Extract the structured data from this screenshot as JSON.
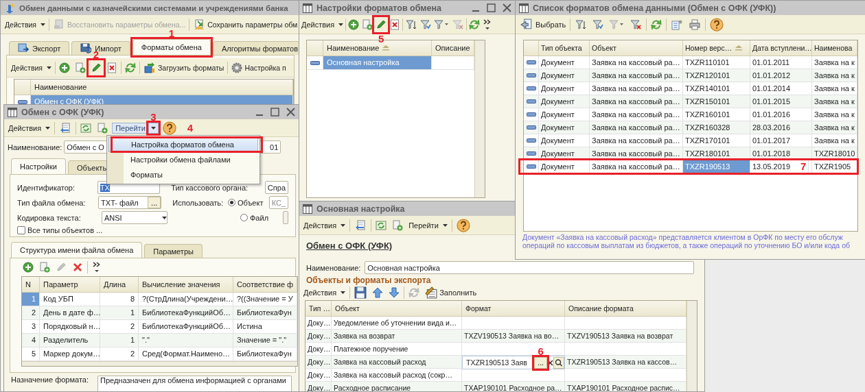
{
  "main_window": {
    "title": "Обмен данными с казначейскими системами и учреждениями банка",
    "toolbar": [
      {
        "kind": "menu",
        "label": "Действия"
      },
      {
        "kind": "sep"
      },
      {
        "kind": "restore",
        "label": "Восстановить параметры обмена...",
        "disabled": true
      },
      {
        "kind": "sep"
      },
      {
        "kind": "save_params",
        "label": "Сохранить параметры обм",
        "disabled": false
      }
    ],
    "tabs": [
      {
        "label": "Экспорт",
        "kind": "export",
        "selected": false
      },
      {
        "label": "Импорт",
        "kind": "import",
        "selected": false
      },
      {
        "label": "Форматы обмена",
        "kind": "plain",
        "selected": true,
        "framed": true,
        "marker": "1"
      },
      {
        "label": "Алгоритмы форматов",
        "kind": "plain",
        "selected": false
      }
    ],
    "toolbar2": [
      {
        "kind": "menu",
        "label": "Действия"
      },
      {
        "kind": "sep"
      },
      {
        "kind": "add"
      },
      {
        "kind": "copy"
      },
      {
        "kind": "edit",
        "framed": true,
        "marker": "2"
      },
      {
        "kind": "delete"
      },
      {
        "kind": "sep"
      },
      {
        "kind": "refresh"
      },
      {
        "kind": "sep"
      },
      {
        "kind": "load",
        "label": "Загрузить форматы"
      },
      {
        "kind": "sep"
      },
      {
        "kind": "gear",
        "label": "Настройка п"
      }
    ],
    "table": {
      "row_icons": true,
      "columns": [
        "Наименование"
      ],
      "rows": [
        {
          "cells": [
            "Обмен с ОФК (УФК)"
          ],
          "selected": true
        }
      ]
    }
  },
  "settings_list_window": {
    "title": "Настройки форматов обмена",
    "window_buttons": true,
    "toolbar": [
      {
        "kind": "menu",
        "label": "Действия"
      },
      {
        "kind": "sep"
      },
      {
        "kind": "add"
      },
      {
        "kind": "copy"
      },
      {
        "kind": "edit",
        "framed": true,
        "marker": "5"
      },
      {
        "kind": "delete"
      },
      {
        "kind": "sep"
      },
      {
        "kind": "filter_sort"
      },
      {
        "kind": "filter"
      },
      {
        "kind": "filter_menu"
      },
      {
        "kind": "filter_clear",
        "disabled": true
      },
      {
        "kind": "sep"
      },
      {
        "kind": "refresh"
      },
      {
        "kind": "more"
      }
    ],
    "table": {
      "row_icons": true,
      "columns": [
        {
          "label": "Наименование",
          "sorted": true
        },
        {
          "label": "Описание",
          "sorted": false
        }
      ],
      "rows": [
        {
          "cells": [
            "Основная настройка",
            null
          ],
          "selected": true
        }
      ]
    }
  },
  "setting_window": {
    "title": "Основная настройка",
    "toolbar": [
      {
        "kind": "menu",
        "label": "Действия"
      },
      {
        "kind": "sep"
      },
      {
        "kind": "back"
      },
      {
        "kind": "sep"
      },
      {
        "kind": "reread"
      },
      {
        "kind": "copy"
      },
      {
        "kind": "menu",
        "label": "Перейти"
      },
      {
        "kind": "sep"
      },
      {
        "kind": "help"
      }
    ],
    "link": "Обмен с ОФК (УФК)",
    "name_label": "Наименование:",
    "name_value": "Основная настройка",
    "section_title": "Объекты и форматы экспорта",
    "toolbar2": [
      {
        "kind": "menu",
        "label": "Действия"
      },
      {
        "kind": "sep"
      },
      {
        "kind": "save_ok"
      },
      {
        "kind": "up"
      },
      {
        "kind": "down"
      },
      {
        "kind": "sep"
      },
      {
        "kind": "refresh",
        "disabled": true
      },
      {
        "kind": "fill",
        "label": "Заполнить"
      }
    ],
    "table": {
      "columns": [
        "Тип …",
        "Объект",
        "Формат",
        "Описание формата"
      ],
      "rows": [
        {
          "cells": [
            "Доку…",
            "Уведомление об уточнении вида и…",
            null,
            null
          ],
          "selected": false
        },
        {
          "cells": [
            "Доку…",
            "Заявка на возврат",
            "TXZV190513 Заявка на во…",
            "TXZV190513 Заявка на возврат"
          ],
          "selected": false
        },
        {
          "cells": [
            "Доку…",
            "Платежное поручение",
            null,
            null
          ],
          "selected": false
        },
        {
          "cells": [
            "Доку…",
            "Заявка на кассовый расход",
            {
              "kind": "editor",
              "text": "TXZR190513 Заяв",
              "button": "...",
              "framed": true,
              "marker": "6"
            },
            "TXZR190513 Заявка на кассов…"
          ],
          "selected": false
        },
        {
          "cells": [
            "Доку…",
            "Заявка на кассовый расход (сокр…",
            null,
            null
          ],
          "selected": false
        },
        {
          "cells": [
            "Доку…",
            "Расходное расписание",
            "TXAP190101 Расходное ра…",
            "TXAP190101 Расходное распис…"
          ],
          "selected": false
        }
      ]
    }
  },
  "formats_list_window": {
    "title": "Список форматов обмена данными (Обмен с ОФК (УФК))",
    "toolbar": [
      {
        "kind": "select",
        "label": "Выбрать"
      },
      {
        "kind": "sep"
      },
      {
        "kind": "filter_sort"
      },
      {
        "kind": "filter"
      },
      {
        "kind": "filter_menu",
        "disabled": true
      },
      {
        "kind": "filter_clear"
      },
      {
        "kind": "sep"
      },
      {
        "kind": "refresh"
      },
      {
        "kind": "sep"
      },
      {
        "kind": "list_settings"
      },
      {
        "kind": "print"
      },
      {
        "kind": "sep"
      },
      {
        "kind": "help"
      }
    ],
    "table": {
      "row_icons": true,
      "columns": [
        {
          "label": "Тип объекта",
          "sorted": false
        },
        {
          "label": "Объект",
          "sorted": false
        },
        {
          "label": "Номер верс…",
          "sorted": true
        },
        {
          "label": "Дата вступлени…",
          "sorted": false
        },
        {
          "label": "Наименова",
          "sorted": false
        }
      ],
      "rows": [
        {
          "cells": [
            "Документ",
            "Заявка на кассовый ра…",
            "TXZR110101",
            "01.01.2011",
            "Заявка на к"
          ],
          "selected": false
        },
        {
          "cells": [
            "Документ",
            "Заявка на кассовый ра…",
            "TXZR120101",
            "01.01.2012",
            "Заявка на к"
          ],
          "selected": false
        },
        {
          "cells": [
            "Документ",
            "Заявка на кассовый ра…",
            "TXZR140101",
            "01.01.2014",
            "Заявка на к"
          ],
          "selected": false
        },
        {
          "cells": [
            "Документ",
            "Заявка на кассовый ра…",
            "TXZR150101",
            "01.01.2015",
            "Заявка на к"
          ],
          "selected": false
        },
        {
          "cells": [
            "Документ",
            "Заявка на кассовый ра…",
            "TXZR160101",
            "01.01.2016",
            "Заявка на к"
          ],
          "selected": false
        },
        {
          "cells": [
            "Документ",
            "Заявка на кассовый ра…",
            "TXZR160328",
            "28.03.2016",
            "Заявка на к"
          ],
          "selected": false
        },
        {
          "cells": [
            "Документ",
            "Заявка на кассовый ра…",
            "TXZR170101",
            "01.01.2017",
            "Заявка на к"
          ],
          "selected": false
        },
        {
          "cells": [
            "Документ",
            "Заявка на кассовый ра…",
            "TXZR180101",
            "01.01.2018",
            "TXZR18010"
          ],
          "selected": false
        },
        {
          "cells": [
            "Документ",
            "Заявка на кассовый ра…",
            {
              "text": "TXZR190513",
              "current": true
            },
            "13.05.2019",
            "TXZR1905"
          ],
          "selected": true,
          "framed": true,
          "marker": "7"
        }
      ]
    },
    "description": [
      "Документ «Заявка на кассовый расход» представляется клиентом в ОрФК по месту его обслуж",
      "операций по кассовым выплатам из бюджетов, а также операций по уточнению БО и/или кода об"
    ]
  },
  "exchange_window": {
    "title": "Обмен с ОФК (УФК)",
    "window_buttons": true,
    "toolbar": [
      {
        "kind": "menu",
        "label": "Действия"
      },
      {
        "kind": "sep"
      },
      {
        "kind": "back"
      },
      {
        "kind": "sep"
      },
      {
        "kind": "reread"
      },
      {
        "kind": "copy"
      },
      {
        "kind": "split",
        "label": "Перейти",
        "framed": true,
        "marker": "3"
      },
      {
        "kind": "help"
      },
      {
        "kind": "note",
        "label": "4"
      }
    ],
    "name_label": "Наименование:",
    "name_value": "Обмен с О",
    "code_value": "01",
    "tabs": [
      {
        "label": "Настройки",
        "selected": true
      },
      {
        "label": "Объекты",
        "selected": false
      }
    ],
    "identifier": {
      "label": "Идентификатор:",
      "value": "TX",
      "text_selected": true
    },
    "org_type": {
      "label": "Тип кассового органа:",
      "value": "Спра"
    },
    "file_type": {
      "label": "Тип файла обмена:",
      "value": "TXT- файл",
      "button": "..."
    },
    "use": {
      "label": "Использовать:",
      "options": [
        {
          "label": "Объект",
          "selected": true,
          "value": "КС_"
        },
        {
          "label": "Файл",
          "selected": false
        }
      ]
    },
    "encoding": {
      "label": "Кодировка текста:",
      "value": "ANSI"
    },
    "all_types": {
      "label": "Все типы объектов ...",
      "checked": false
    },
    "inner_tabs": [
      {
        "label": "Структура имени файла обмена",
        "selected": true
      },
      {
        "label": "Параметры",
        "selected": false
      }
    ],
    "inner_toolbar": [
      {
        "kind": "add"
      },
      {
        "kind": "copy"
      },
      {
        "kind": "edit",
        "disabled": true
      },
      {
        "kind": "delete_x"
      },
      {
        "kind": "sep"
      },
      {
        "kind": "more"
      }
    ],
    "table": {
      "columns": [
        "N",
        "Параметр",
        "Длина",
        "Вычисление значения",
        "Соответствие ф"
      ],
      "rows": [
        {
          "cells": [
            {
              "text": "1",
              "current": true
            },
            "Код УБП",
            "8",
            "?(СтрДлина(Учреждени…",
            "?((Значение = У"
          ],
          "selected": true
        },
        {
          "cells": [
            "2",
            "День в дате ф…",
            "1",
            "БиблиотекаФункцийОб…",
            "БиблиотекаФун"
          ],
          "selected": false
        },
        {
          "cells": [
            "3",
            "Порядковый н…",
            "2",
            "БиблиотекаФункцийОб…",
            "Истина"
          ],
          "selected": false
        },
        {
          "cells": [
            "4",
            "Разделитель",
            "1",
            "\".\"",
            "Значение = \".\""
          ],
          "selected": false
        },
        {
          "cells": [
            "5",
            "Маркер докум…",
            "2",
            "Сред(Формат.Наимено…",
            "БиблиотекаФун"
          ],
          "selected": false
        }
      ]
    },
    "purpose": {
      "label": "Назначение формата:",
      "value": "Предназначен для обмена информацией с органами"
    }
  },
  "dropdown_menu": {
    "items": [
      {
        "label": "Настройка форматов обмена",
        "selected": true,
        "framed": true
      },
      {
        "label": "Настройки обмена файлами",
        "selected": false
      },
      {
        "label": "Форматы",
        "selected": false
      }
    ]
  }
}
